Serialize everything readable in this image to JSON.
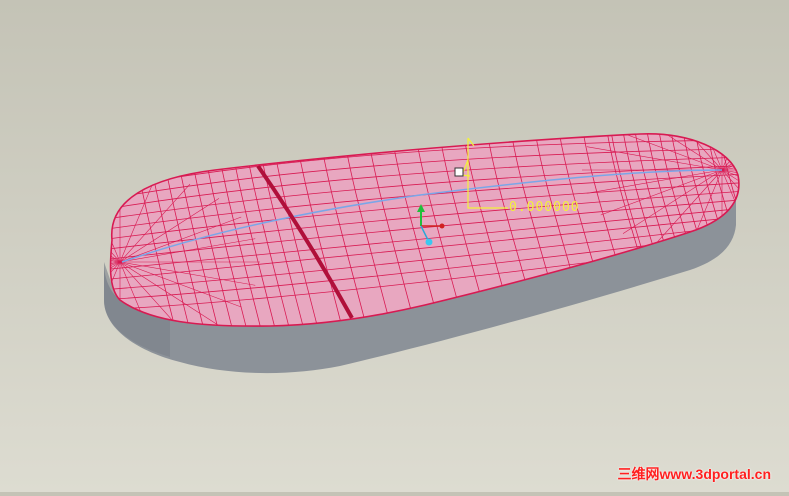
{
  "viewport": {
    "background_color": "#cfcec2",
    "surface_fill": "#e8a7c0",
    "mesh_line_color": "#d81a52",
    "boundary_curve_color": "#b0103a",
    "side_wall_color": "#8c9299",
    "spine_curve_color": "#7aa6e8",
    "dimension_color": "#f2f23a"
  },
  "dimension": {
    "value": "0.000000"
  },
  "coord_axes": {
    "icon": "coordinate-axes-icon"
  },
  "watermark": {
    "text": "三维网www.3dportal.cn"
  }
}
